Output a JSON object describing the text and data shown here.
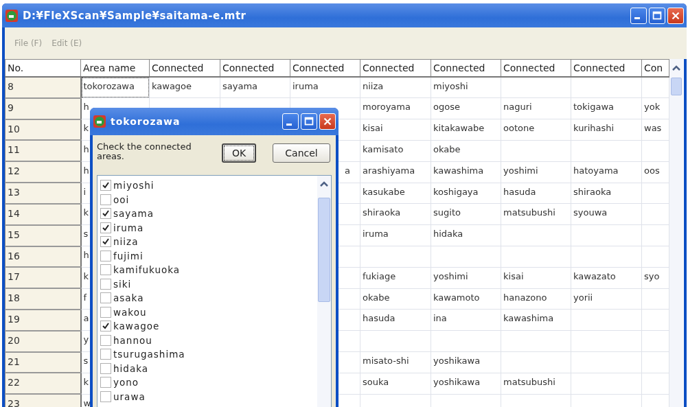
{
  "window": {
    "title": "D:¥FleXScan¥Sample¥saitama-e.mtr"
  },
  "menu": [
    {
      "label": "File (F)",
      "disabled": true
    },
    {
      "label": "Edit (E)",
      "disabled": true
    }
  ],
  "table": {
    "columns": [
      "No.",
      "Area name",
      "Connected",
      "Connected",
      "Connected",
      "Connected",
      "Connected",
      "Connected",
      "Connected",
      "Con"
    ],
    "rows": [
      {
        "focused": true,
        "cells": [
          "8",
          "tokorozawa",
          "kawagoe",
          "sayama",
          "iruma",
          "niiza",
          "miyoshi",
          null,
          null,
          null
        ]
      },
      {
        "focused": false,
        "cells": [
          "9",
          "h",
          null,
          null,
          null,
          "moroyama",
          "ogose",
          "naguri",
          "tokigawa",
          "yok"
        ]
      },
      {
        "focused": false,
        "cells": [
          "10",
          "k",
          null,
          null,
          null,
          "kisai",
          "kitakawabe",
          "ootone",
          "kurihashi",
          "was"
        ]
      },
      {
        "focused": false,
        "cells": [
          "11",
          "h",
          null,
          null,
          null,
          "kamisato",
          "okabe",
          null,
          null,
          null
        ]
      },
      {
        "focused": false,
        "cells": [
          "12",
          "h",
          null,
          null,
          "a",
          "arashiyama",
          "kawashima",
          "yoshimi",
          "hatoyama",
          "oos"
        ]
      },
      {
        "focused": false,
        "cells": [
          "13",
          "i",
          null,
          null,
          null,
          "kasukabe",
          "koshigaya",
          "hasuda",
          "shiraoka",
          null
        ]
      },
      {
        "focused": false,
        "cells": [
          "14",
          "k",
          null,
          null,
          null,
          "shiraoka",
          "sugito",
          "matsubushi",
          "syouwa",
          null
        ]
      },
      {
        "focused": false,
        "cells": [
          "15",
          "s",
          null,
          null,
          null,
          "iruma",
          "hidaka",
          null,
          null,
          null
        ]
      },
      {
        "focused": false,
        "cells": [
          "16",
          "h",
          null,
          null,
          null,
          null,
          null,
          null,
          null,
          null
        ]
      },
      {
        "focused": false,
        "cells": [
          "17",
          "k",
          null,
          null,
          null,
          "fukiage",
          "yoshimi",
          "kisai",
          "kawazato",
          "syo"
        ]
      },
      {
        "focused": false,
        "cells": [
          "18",
          "f",
          null,
          null,
          null,
          "okabe",
          "kawamoto",
          "hanazono",
          "yorii",
          null
        ]
      },
      {
        "focused": false,
        "cells": [
          "19",
          "a",
          null,
          null,
          null,
          "hasuda",
          "ina",
          "kawashima",
          null,
          null
        ]
      },
      {
        "focused": false,
        "cells": [
          "20",
          "y",
          null,
          null,
          null,
          null,
          null,
          null,
          null,
          null
        ]
      },
      {
        "focused": false,
        "cells": [
          "21",
          "s",
          null,
          null,
          null,
          "misato-shi",
          "yoshikawa",
          null,
          null,
          null
        ]
      },
      {
        "focused": false,
        "cells": [
          "22",
          "k",
          null,
          null,
          null,
          "souka",
          "yoshikawa",
          "matsubushi",
          null,
          null
        ]
      },
      {
        "focused": false,
        "cells": [
          "23",
          "w",
          null,
          null,
          null,
          null,
          null,
          null,
          null,
          null
        ]
      }
    ]
  },
  "dialog": {
    "title": "tokorozawa",
    "instruction": "Check the connected areas.",
    "ok": "OK",
    "cancel": "Cancel",
    "items": [
      {
        "label": "miyoshi",
        "checked": true
      },
      {
        "label": "ooi",
        "checked": false
      },
      {
        "label": "sayama",
        "checked": true
      },
      {
        "label": "iruma",
        "checked": true
      },
      {
        "label": "niiza",
        "checked": true
      },
      {
        "label": "fujimi",
        "checked": false
      },
      {
        "label": "kamifukuoka",
        "checked": false
      },
      {
        "label": "siki",
        "checked": false
      },
      {
        "label": "asaka",
        "checked": false
      },
      {
        "label": "wakou",
        "checked": false
      },
      {
        "label": "kawagoe",
        "checked": true
      },
      {
        "label": "hannou",
        "checked": false
      },
      {
        "label": "tsurugashima",
        "checked": false
      },
      {
        "label": "hidaka",
        "checked": false
      },
      {
        "label": "yono",
        "checked": false
      },
      {
        "label": "urawa",
        "checked": false
      }
    ]
  }
}
